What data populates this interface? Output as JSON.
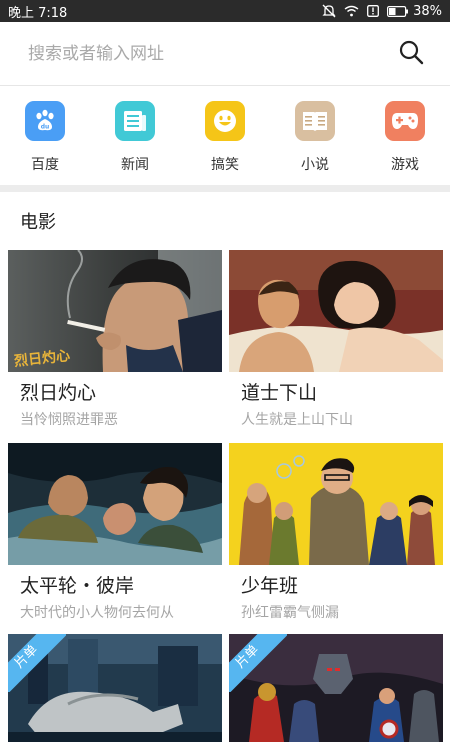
{
  "status_bar": {
    "time": "晚上 7:18",
    "battery": "38%"
  },
  "search": {
    "placeholder": "搜索或者输入网址"
  },
  "quick_links": [
    {
      "label": "百度",
      "icon": "baidu-paw-icon",
      "color": "#4a9ef5"
    },
    {
      "label": "新闻",
      "icon": "news-icon",
      "color": "#41c9d6"
    },
    {
      "label": "搞笑",
      "icon": "smile-icon",
      "color": "#f5c518"
    },
    {
      "label": "小说",
      "icon": "book-icon",
      "color": "#d9bfa0"
    },
    {
      "label": "游戏",
      "icon": "gamepad-icon",
      "color": "#f08060"
    }
  ],
  "section": {
    "title": "电影"
  },
  "movies": [
    {
      "title": "烈日灼心",
      "subtitle": "当怜悯照进罪恶",
      "poster_text": "烈日灼心"
    },
    {
      "title": "道士下山",
      "subtitle": "人生就是上山下山"
    },
    {
      "title": "太平轮・彼岸",
      "subtitle": "大时代的小人物何去何从"
    },
    {
      "title": "少年班",
      "subtitle": "孙红雷霸气侧漏"
    },
    {
      "badge": "片单"
    },
    {
      "badge": "片单"
    }
  ]
}
